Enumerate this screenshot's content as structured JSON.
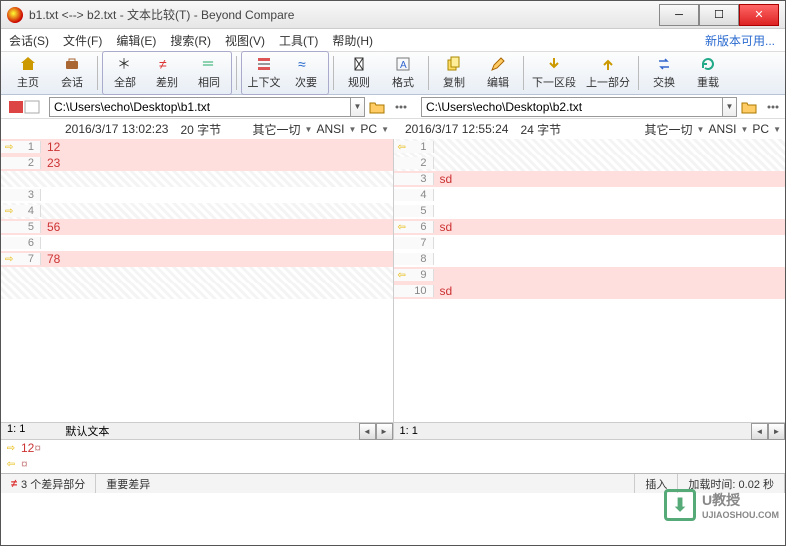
{
  "title": "b1.txt <--> b2.txt - 文本比较(T) - Beyond Compare",
  "menu": [
    "会话(S)",
    "文件(F)",
    "编辑(E)",
    "搜索(R)",
    "视图(V)",
    "工具(T)",
    "帮助(H)"
  ],
  "new_version": "新版本可用...",
  "toolbar": {
    "home": "主页",
    "sessions": "会话",
    "all": "全部",
    "diff": "差别",
    "same": "相同",
    "context": "上下文",
    "minor": "次要",
    "rules": "规则",
    "format": "格式",
    "copy": "复制",
    "edit": "编辑",
    "next": "下一区段",
    "prev": "上一部分",
    "swap": "交换",
    "reload": "重载"
  },
  "left": {
    "path": "C:\\Users\\echo\\Desktop\\b1.txt",
    "date": "2016/3/17 13:02:23",
    "size": "20 字节",
    "other": "其它一切",
    "enc": "ANSI",
    "plat": "PC",
    "lines": [
      {
        "n": 1,
        "t": "12",
        "bg": "red",
        "arr": "R",
        "tred": true
      },
      {
        "n": 2,
        "t": "23",
        "bg": "red",
        "arr": "",
        "tred": true
      },
      {
        "n": "",
        "t": "",
        "bg": "hatch",
        "arr": ""
      },
      {
        "n": 3,
        "t": "",
        "bg": "",
        "arr": ""
      },
      {
        "n": 4,
        "t": "",
        "bg": "hatch",
        "arr": "R"
      },
      {
        "n": 5,
        "t": "56",
        "bg": "red",
        "arr": "",
        "tred": true
      },
      {
        "n": 6,
        "t": "",
        "bg": "",
        "arr": ""
      },
      {
        "n": 7,
        "t": "78",
        "bg": "red",
        "arr": "R",
        "tred": true
      },
      {
        "n": "",
        "t": "",
        "bg": "hatch",
        "arr": ""
      },
      {
        "n": "",
        "t": "",
        "bg": "hatch",
        "arr": ""
      }
    ],
    "pos": "1: 1",
    "mode": "默认文本"
  },
  "right": {
    "path": "C:\\Users\\echo\\Desktop\\b2.txt",
    "date": "2016/3/17 12:55:24",
    "size": "24 字节",
    "other": "其它一切",
    "enc": "ANSI",
    "plat": "PC",
    "lines": [
      {
        "n": 1,
        "t": "",
        "bg": "hatch",
        "arr": "L"
      },
      {
        "n": 2,
        "t": "",
        "bg": "hatch",
        "arr": ""
      },
      {
        "n": 3,
        "t": "sd",
        "bg": "red",
        "arr": "",
        "tred": true
      },
      {
        "n": 4,
        "t": "",
        "bg": "",
        "arr": ""
      },
      {
        "n": 5,
        "t": "",
        "bg": "",
        "arr": ""
      },
      {
        "n": 6,
        "t": "sd",
        "bg": "red",
        "arr": "L",
        "tred": true
      },
      {
        "n": 7,
        "t": "",
        "bg": "",
        "arr": ""
      },
      {
        "n": 8,
        "t": "",
        "bg": "",
        "arr": ""
      },
      {
        "n": 9,
        "t": "",
        "bg": "red",
        "arr": "L"
      },
      {
        "n": 10,
        "t": "sd",
        "bg": "red",
        "arr": "",
        "tred": true
      }
    ],
    "pos": "1: 1"
  },
  "merge": {
    "l1": "12",
    "l2": ""
  },
  "status": {
    "diffs": "3 个差异部分",
    "important": "重要差异",
    "insert": "插入",
    "load": "加载时间: 0.02 秒"
  },
  "watermark": {
    "brand": "U教授",
    "url": "UJIAOSHOU.COM"
  }
}
